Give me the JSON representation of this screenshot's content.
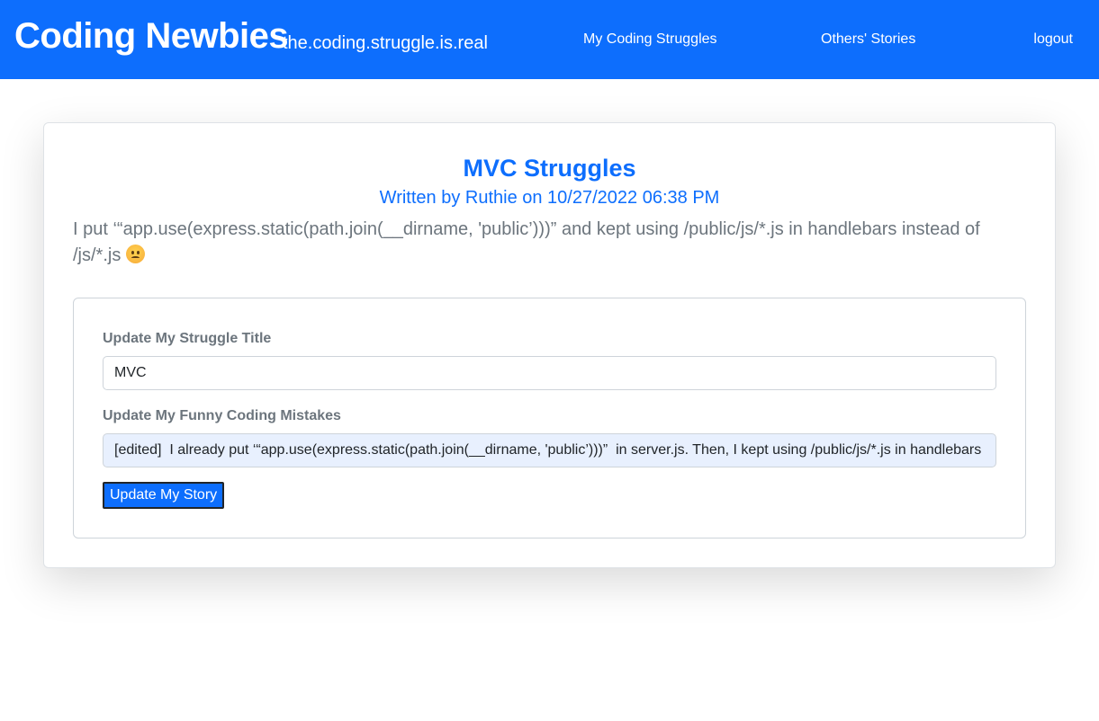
{
  "header": {
    "brand": "Coding Newbies",
    "tagline": "the.coding.struggle.is.real",
    "nav": {
      "my_struggles": "My Coding Struggles",
      "others_stories": "Others' Stories",
      "logout": "logout"
    }
  },
  "story": {
    "title": "MVC Struggles",
    "byline": "Written by Ruthie on 10/27/2022 06:38 PM",
    "body": "I put ‘“app.use(express.static(path.join(__dirname, 'public’)))” and kept using /public/js/*.js in handlebars instead of /js/*.js",
    "emoji_icon": "angry-face-icon"
  },
  "edit_form": {
    "title_label": "Update My Struggle Title",
    "title_value": "MVC",
    "body_label": "Update My Funny Coding Mistakes",
    "body_value": "[edited]  I already put ‘“app.use(express.static(path.join(__dirname, 'public’)))”  in server.js. Then, I kept using /public/js/*.js in handlebars instead of /js/*.js",
    "submit_label": "Update My Story"
  },
  "colors": {
    "primary": "#0d6efd",
    "muted_text": "#6c757d",
    "autofill_bg": "#e8f0fe"
  }
}
